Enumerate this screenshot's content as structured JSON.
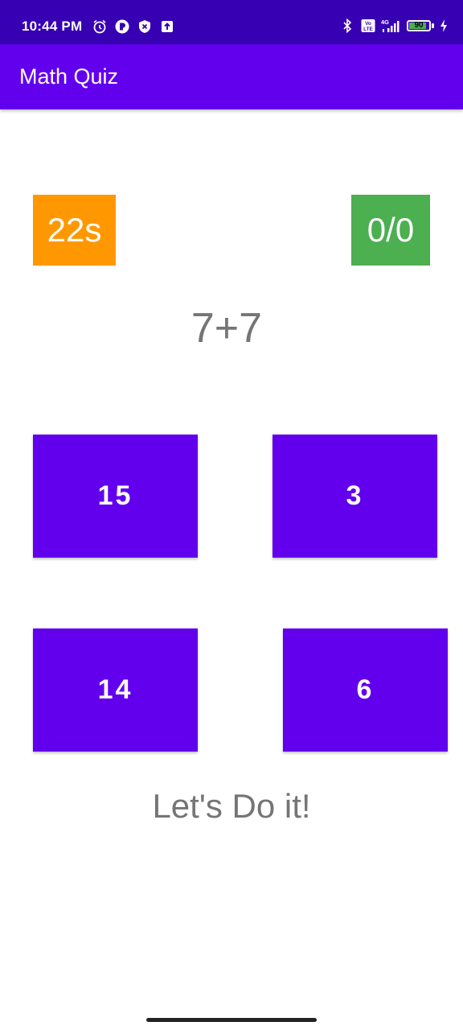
{
  "status_bar": {
    "time": "10:44 PM",
    "battery_level": "90",
    "battery_fraction": 0.9,
    "left_icons": [
      "alarm-icon",
      "app-notification-icon",
      "shield-icon",
      "upload-icon"
    ],
    "right_icons": [
      "bluetooth-icon",
      "volte-icon",
      "signal-4g-icon",
      "battery-icon",
      "charging-icon"
    ],
    "volte_label": "Vo LTE",
    "network_label": "4G"
  },
  "app_bar": {
    "title": "Math Quiz"
  },
  "quiz": {
    "timer": "22s",
    "score": "0/0",
    "question": "7+7",
    "answers": [
      "15",
      "3",
      "14",
      "6"
    ],
    "message": "Let's Do it!"
  },
  "colors": {
    "status_bar": "#3700B3",
    "primary": "#6200EE",
    "timer_bg": "#FF9800",
    "score_bg": "#4CAF50",
    "text_gray": "#757575"
  }
}
